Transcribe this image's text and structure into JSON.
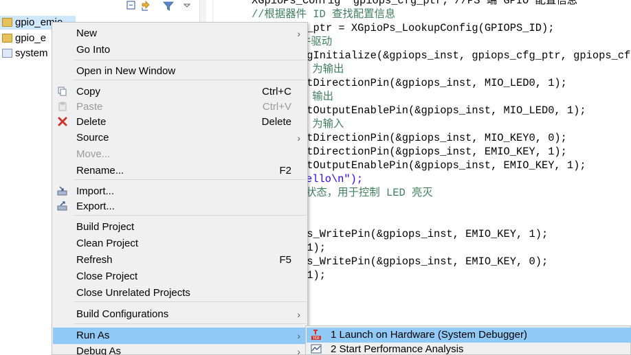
{
  "explorer": {
    "toolbar_icons": [
      "collapse-all-icon",
      "link-with-editor-icon",
      "filter-icon",
      "view-menu-icon"
    ],
    "items": [
      {
        "label": "gpio_emio",
        "icon": "folder-icon"
      },
      {
        "label": "gpio_e",
        "icon": "folder-icon"
      },
      {
        "label": "system",
        "icon": "system-project-icon"
      }
    ]
  },
  "editor": {
    "lines": [
      {
        "text": "XGpioPs_Config *gpiops_cfg_ptr; //PS 端 GPIO 配置信息",
        "kind": "code"
      },
      {
        "text": "//根据器件 ID 查找配置信息",
        "kind": "comment"
      },
      {
        "text": "g_ptr = XGpioPs_LookupConfig(GPIOPS_ID);",
        "kind": "code"
      },
      {
        "text": "件驱动",
        "kind": "comment"
      },
      {
        "text": "fgInitialize(&gpiops_inst, gpiops_cfg_ptr, gpiops_cfg",
        "kind": "code"
      },
      {
        "text": " 为输出",
        "kind": "comment"
      },
      {
        "text": "etDirectionPin(&gpiops_inst, MIO_LED0, 1);",
        "kind": "code"
      },
      {
        "text": " 输出",
        "kind": "comment"
      },
      {
        "text": "etOutputEnablePin(&gpiops_inst, MIO_LED0, 1);",
        "kind": "code"
      },
      {
        "text": " 为输入",
        "kind": "comment"
      },
      {
        "text": "etDirectionPin(&gpiops_inst, MIO_KEY0, 0);",
        "kind": "code"
      },
      {
        "text": "etDirectionPin(&gpiops_inst, EMIO_KEY, 1);",
        "kind": "code"
      },
      {
        "text": "etOutputEnablePin(&gpiops_inst, EMIO_KEY, 1);",
        "kind": "code"
      },
      {
        "text": "ello\\n\");",
        "kind": "string"
      },
      {
        "text": "状态，用于控制 LED 亮灭",
        "kind": "comment"
      },
      {
        "text": "",
        "kind": "code"
      },
      {
        "text": "",
        "kind": "code"
      },
      {
        "text": "Ps_WritePin(&gpiops_inst, EMIO_KEY, 1);",
        "kind": "code"
      },
      {
        "text": "(1);",
        "kind": "code"
      },
      {
        "text": "Ps_WritePin(&gpiops_inst, EMIO_KEY, 0);",
        "kind": "code"
      },
      {
        "text": "(1);",
        "kind": "code"
      }
    ]
  },
  "context_menu": {
    "items": [
      {
        "label": "New",
        "shortcut": "",
        "submenu": true,
        "icon": "",
        "disabled": false
      },
      {
        "label": "Go Into",
        "shortcut": "",
        "submenu": false,
        "icon": "",
        "disabled": false
      },
      {
        "label": "Open in New Window",
        "shortcut": "",
        "submenu": false,
        "icon": "",
        "disabled": false
      },
      {
        "label": "Copy",
        "shortcut": "Ctrl+C",
        "submenu": false,
        "icon": "copy-icon",
        "disabled": false
      },
      {
        "label": "Paste",
        "shortcut": "Ctrl+V",
        "submenu": false,
        "icon": "paste-icon",
        "disabled": true
      },
      {
        "label": "Delete",
        "shortcut": "Delete",
        "submenu": false,
        "icon": "delete-icon",
        "disabled": false
      },
      {
        "label": "Source",
        "shortcut": "",
        "submenu": true,
        "icon": "",
        "disabled": false
      },
      {
        "label": "Move...",
        "shortcut": "",
        "submenu": false,
        "icon": "",
        "disabled": true
      },
      {
        "label": "Rename...",
        "shortcut": "F2",
        "submenu": false,
        "icon": "",
        "disabled": false
      },
      {
        "label": "Import...",
        "shortcut": "",
        "submenu": false,
        "icon": "import-icon",
        "disabled": false
      },
      {
        "label": "Export...",
        "shortcut": "",
        "submenu": false,
        "icon": "export-icon",
        "disabled": false
      },
      {
        "label": "Build Project",
        "shortcut": "",
        "submenu": false,
        "icon": "",
        "disabled": false
      },
      {
        "label": "Clean Project",
        "shortcut": "",
        "submenu": false,
        "icon": "",
        "disabled": false
      },
      {
        "label": "Refresh",
        "shortcut": "F5",
        "submenu": false,
        "icon": "",
        "disabled": false
      },
      {
        "label": "Close Project",
        "shortcut": "",
        "submenu": false,
        "icon": "",
        "disabled": false
      },
      {
        "label": "Close Unrelated Projects",
        "shortcut": "",
        "submenu": false,
        "icon": "",
        "disabled": false
      },
      {
        "label": "Build Configurations",
        "shortcut": "",
        "submenu": true,
        "icon": "",
        "disabled": false
      },
      {
        "label": "Run As",
        "shortcut": "",
        "submenu": true,
        "icon": "",
        "disabled": false,
        "highlighted": true
      },
      {
        "label": "Debug As",
        "shortcut": "",
        "submenu": true,
        "icon": "",
        "disabled": false
      }
    ]
  },
  "submenu": {
    "items": [
      {
        "label": "1 Launch on Hardware (System Debugger)",
        "icon": "tcf-launch-icon",
        "highlighted": true
      },
      {
        "label": "2 Start Performance Analysis",
        "icon": "performance-analysis-icon",
        "highlighted": false
      }
    ]
  },
  "icon_glyphs": {
    "tcf_badge": "TCF"
  },
  "colors": {
    "selection": "#cde8ff",
    "menu_highlight": "#91c9f7",
    "comment": "#3f7f5f",
    "string": "#2a00ff"
  }
}
